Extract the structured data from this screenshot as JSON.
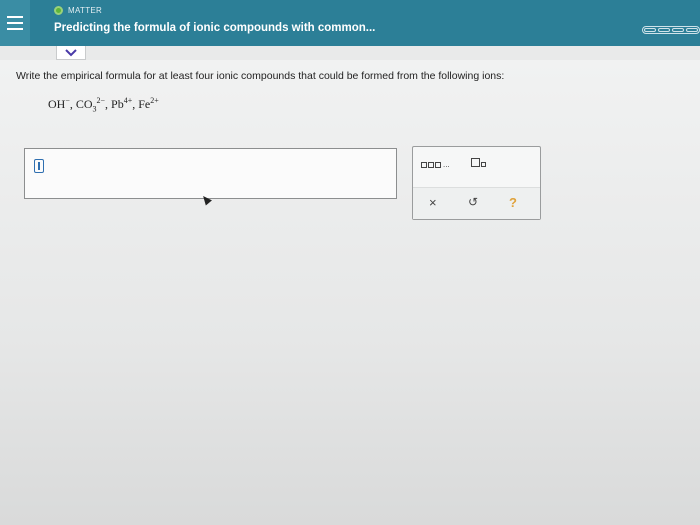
{
  "header": {
    "topic": "MATTER",
    "title": "Predicting the formula of ionic compounds with common..."
  },
  "question": {
    "prompt": "Write the empirical formula for at least four ionic compounds that could be formed from the following ions:",
    "ions": [
      {
        "base": "OH",
        "sub": "",
        "sup": "−"
      },
      {
        "base": "CO",
        "sub": "3",
        "sup": "2−"
      },
      {
        "base": "Pb",
        "sub": "",
        "sup": "4+"
      },
      {
        "base": "Fe",
        "sub": "",
        "sup": "2+"
      }
    ]
  },
  "toolbar": {
    "multi_dots": "...",
    "clear_label": "×",
    "undo_label": "↺",
    "help_label": "?"
  },
  "colors": {
    "header_bg": "#2c7f97",
    "topic_dot": "#5fb53a",
    "help": "#e0a23b"
  }
}
